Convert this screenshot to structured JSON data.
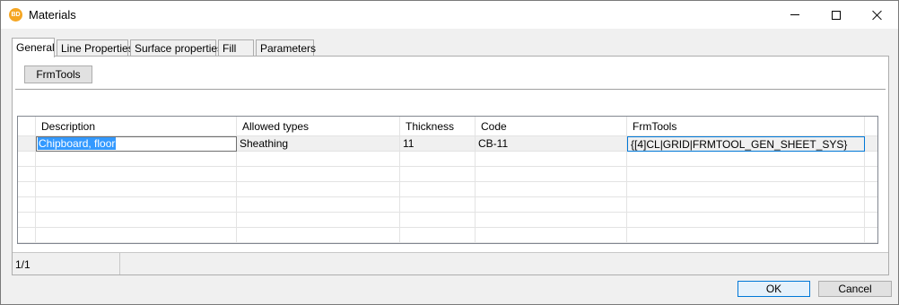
{
  "window": {
    "title": "Materials",
    "app_icon_text": "BD"
  },
  "tabs": [
    {
      "label": "General",
      "active": true
    },
    {
      "label": "Line Properties",
      "active": false
    },
    {
      "label": "Surface properties",
      "active": false
    },
    {
      "label": "Fill",
      "active": false
    },
    {
      "label": "Parameters",
      "active": false
    }
  ],
  "toolbar": {
    "frmtools_label": "FrmTools"
  },
  "grid": {
    "columns": [
      "Description",
      "Allowed types",
      "Thickness",
      "Code",
      "FrmTools"
    ],
    "rows": [
      {
        "description": "Chipboard, floor",
        "allowed_types": "Sheathing",
        "thickness": "11",
        "code": "CB-11",
        "frmtools": "{[4]CL|GRID|FRMTOOL_GEN_SHEET_SYS}"
      }
    ]
  },
  "status": {
    "record_count": "1/1"
  },
  "buttons": {
    "ok_label": "OK",
    "cancel_label": "Cancel"
  },
  "colors": {
    "selection": "#3399ff",
    "accent": "#0078d7"
  }
}
